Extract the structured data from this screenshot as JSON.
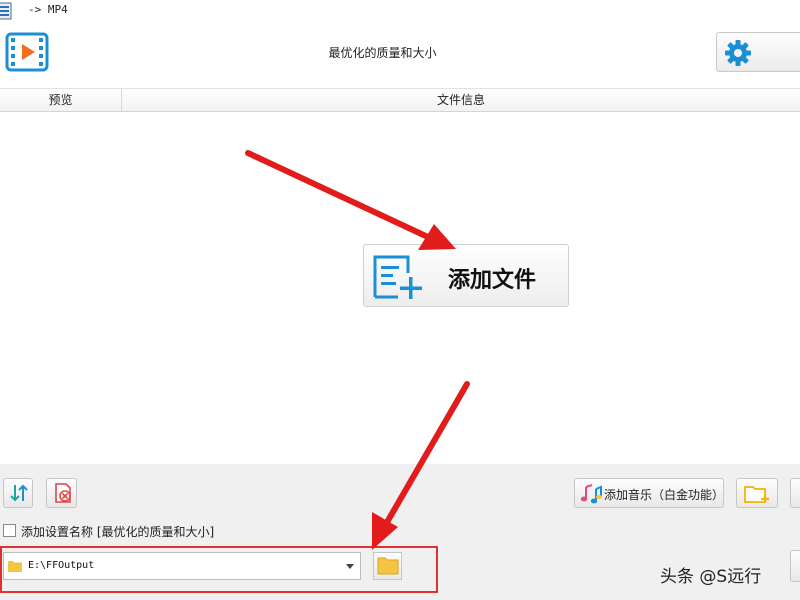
{
  "window": {
    "title": "-> MP4"
  },
  "header": {
    "profile_title": "最优化的质量和大小"
  },
  "columns": {
    "preview": "预览",
    "file_info": "文件信息"
  },
  "add_file": {
    "label": "添加文件"
  },
  "toolbar": {
    "music_label": "添加音乐（白金功能）"
  },
  "options": {
    "add_setting_name_label": "添加设置名称 [最优化的质量和大小]",
    "add_setting_name_checked": false
  },
  "output": {
    "path": "E:\\FFOutput"
  },
  "watermark": {
    "text": "头条 @S远行"
  },
  "colors": {
    "accent_blue": "#1b8fd6",
    "folder_yellow": "#f5c542",
    "arrow_red": "#e21b1b",
    "highlight_red": "#e23030",
    "delete_red": "#e14545"
  }
}
